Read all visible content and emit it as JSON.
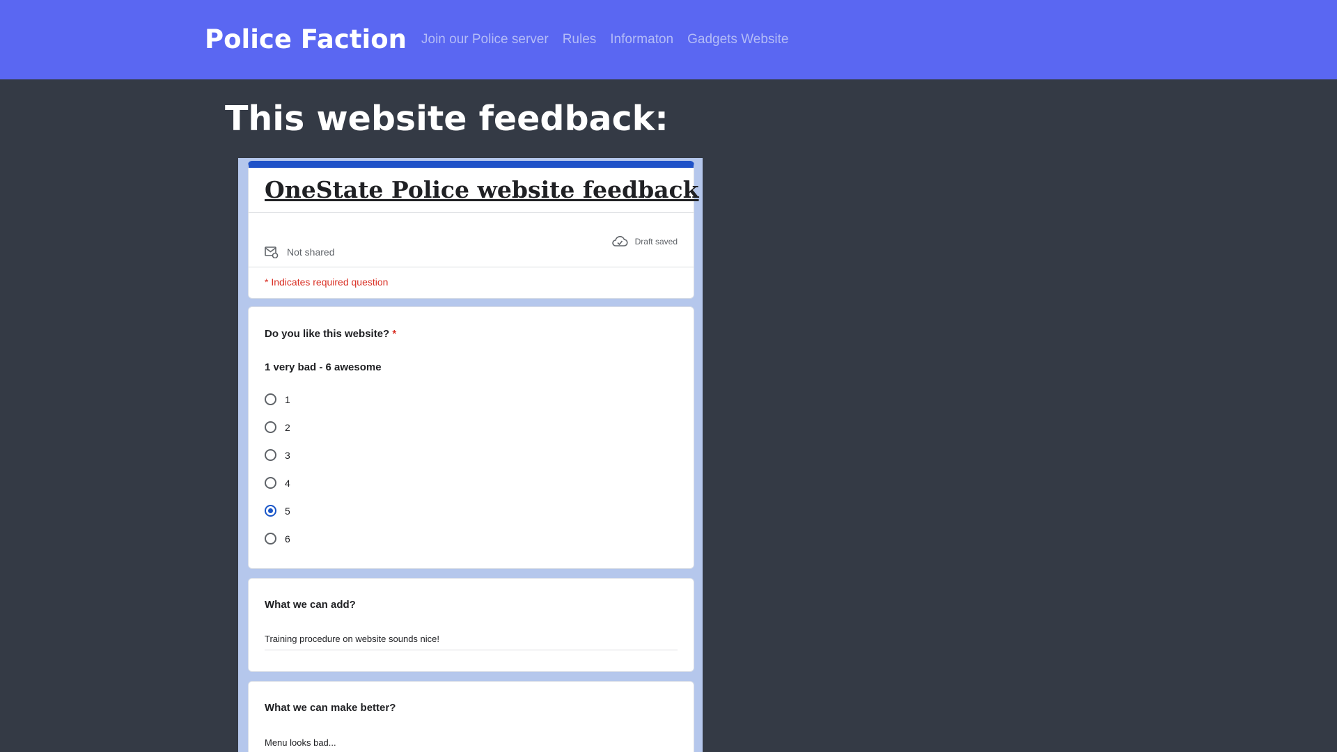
{
  "navbar": {
    "brand": "Police Faction",
    "links": [
      "Join our Police server",
      "Rules",
      "Informaton",
      "Gadgets Website"
    ]
  },
  "page": {
    "heading": "This website feedback:"
  },
  "form": {
    "title": "OneState Police website feedback",
    "sharing_status": "Not shared",
    "save_status": "Draft saved",
    "required_note": "* Indicates required question",
    "accent_color": "#1f52c8",
    "questions": [
      {
        "title": "Do you like this website?",
        "required_mark": "*",
        "description": "1 very bad - 6 awesome",
        "options": [
          "1",
          "2",
          "3",
          "4",
          "5",
          "6"
        ],
        "selected": "5"
      },
      {
        "title": "What we can add?",
        "answer": "Training procedure on website sounds nice!"
      },
      {
        "title": "What we can make better?",
        "answer": "Menu looks bad..."
      }
    ]
  }
}
